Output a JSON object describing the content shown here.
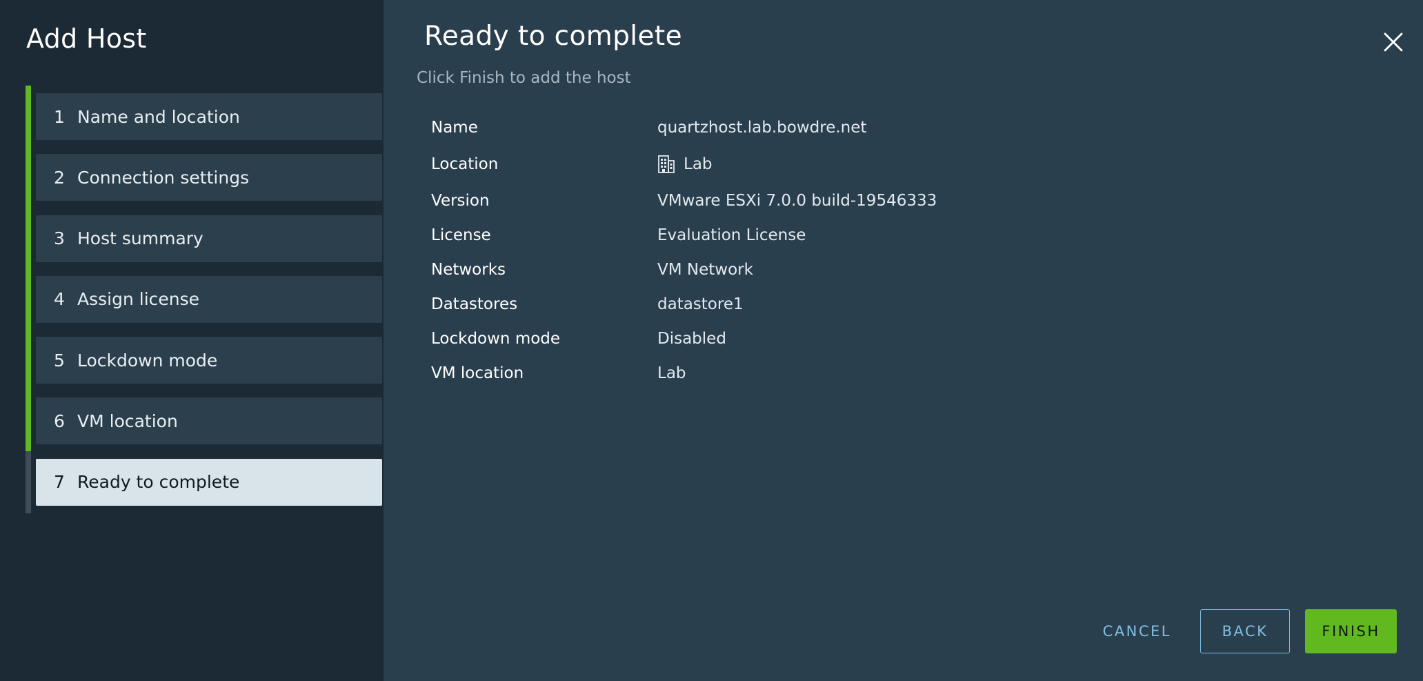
{
  "wizard": {
    "title": "Add Host",
    "steps": [
      {
        "number": "1",
        "label": "Name and location"
      },
      {
        "number": "2",
        "label": "Connection settings"
      },
      {
        "number": "3",
        "label": "Host summary"
      },
      {
        "number": "4",
        "label": "Assign license"
      },
      {
        "number": "5",
        "label": "Lockdown mode"
      },
      {
        "number": "6",
        "label": "VM location"
      },
      {
        "number": "7",
        "label": "Ready to complete"
      }
    ],
    "active_step": 7
  },
  "page": {
    "title": "Ready to complete",
    "subtitle": "Click Finish to add the host"
  },
  "summary": [
    {
      "label": "Name",
      "value": "quartzhost.lab.bowdre.net"
    },
    {
      "label": "Location",
      "value": "Lab",
      "icon": "datacenter-icon"
    },
    {
      "label": "Version",
      "value": "VMware ESXi 7.0.0 build-19546333"
    },
    {
      "label": "License",
      "value": "Evaluation License"
    },
    {
      "label": "Networks",
      "value": "VM Network"
    },
    {
      "label": "Datastores",
      "value": "datastore1"
    },
    {
      "label": "Lockdown mode",
      "value": "Disabled"
    },
    {
      "label": "VM location",
      "value": "Lab"
    }
  ],
  "footer": {
    "cancel_label": "CANCEL",
    "back_label": "BACK",
    "finish_label": "FINISH"
  },
  "colors": {
    "accent_green": "#62b81f",
    "link_blue": "#7fc0e0",
    "sidebar_bg": "#1b2a34",
    "content_bg": "#2a3f4e"
  }
}
